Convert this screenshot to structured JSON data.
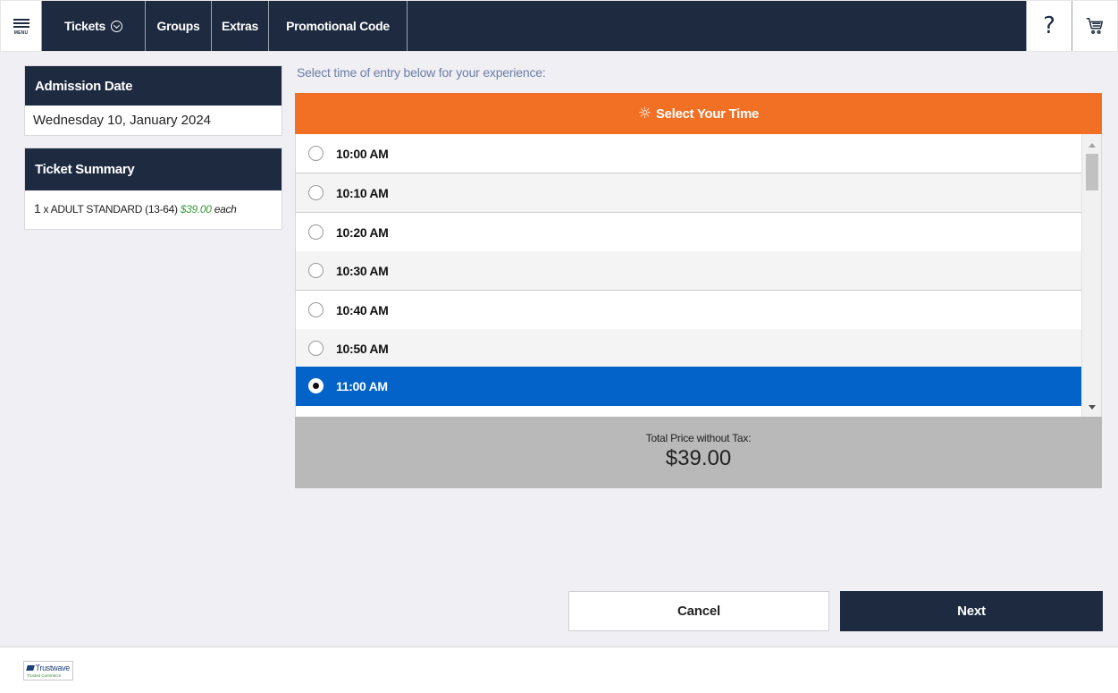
{
  "nav": {
    "menu_label": "MENU",
    "items": [
      "Tickets",
      "Groups",
      "Extras",
      "Promotional Code"
    ],
    "help_glyph": "?",
    "colors": {
      "nav_bg": "#1d2a40",
      "accent": "#f27024",
      "selected": "#0363c8"
    }
  },
  "admission": {
    "title": "Admission Date",
    "date": "Wednesday 10, January 2024"
  },
  "summary": {
    "title": "Ticket Summary",
    "qty": "1",
    "ticket": "x ADULT STANDARD (13-64)",
    "price": "$39.00",
    "each": "each"
  },
  "main": {
    "instruction": "Select time of entry below for your experience:",
    "panel_title": "Select Your Time",
    "times": [
      "10:00 AM",
      "10:10 AM",
      "10:20 AM",
      "10:30 AM",
      "10:40 AM",
      "10:50 AM",
      "11:00 AM"
    ],
    "selected_time": "11:00 AM",
    "total_label": "Total Price without Tax:",
    "total_value": "$39.00"
  },
  "actions": {
    "cancel": "Cancel",
    "next": "Next"
  },
  "footer": {
    "logo_text": "Trustwave",
    "logo_sub": "Trusted Commerce"
  }
}
